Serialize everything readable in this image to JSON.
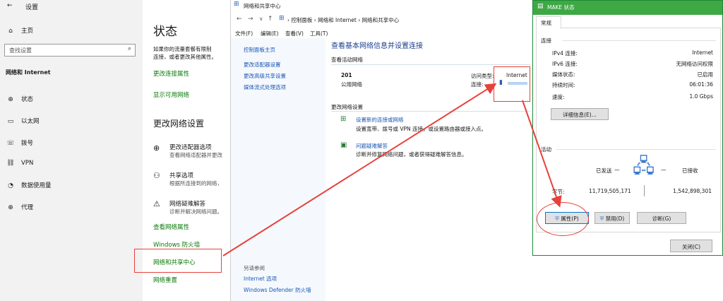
{
  "settings": {
    "title": "设置",
    "home": "主页",
    "search_placeholder": "查找设置",
    "section": "网络和 Internet",
    "nav": [
      "状态",
      "以太网",
      "拨号",
      "VPN",
      "数据使用量",
      "代理"
    ],
    "page_title": "状态",
    "intro": "如果你的流量套餐有限制",
    "intro2": "连接，或者更改其他属性。",
    "change_conn_props": "更改连接属性",
    "show_networks": "显示可用网络",
    "change_settings": "更改网络设置",
    "adapter_title": "更改适配器选项",
    "adapter_desc": "查看网络适配器并更改",
    "sharing_title": "共享选项",
    "sharing_desc": "根据所连接到的网络，",
    "trouble_title": "网络疑难解答",
    "trouble_desc": "诊断并解决网络问题。",
    "view_props": "查看网络属性",
    "firewall": "Windows 防火墙",
    "sharing_center": "网络和共享中心",
    "reset": "网络重置"
  },
  "cp": {
    "title": "网络和共享中心",
    "breadcrumb": [
      "控制面板",
      "网络和 Internet",
      "网络和共享中心"
    ],
    "menu": [
      "文件(F)",
      "编辑(E)",
      "查看(V)",
      "工具(T)"
    ],
    "left_home": "控制面板主页",
    "left_links": [
      "更改适配器设置",
      "更改高级共享设置",
      "媒体流式处理选项"
    ],
    "heading": "查看基本网络信息并设置连接",
    "active_label": "查看活动网络",
    "net_name": "201",
    "net_type": "公用网络",
    "access_label": "访问类型:",
    "access_value": "Internet",
    "conn_label": "连接:",
    "change_label": "更改网络设置",
    "new_conn_title": "设置新的连接或网络",
    "new_conn_desc": "设置宽带、拨号或 VPN 连接，或设置路由器或接入点。",
    "trouble_title": "问题疑难解答",
    "trouble_desc": "诊断并修复网络问题，或者获得疑难解答信息。",
    "see_also": "另请参阅",
    "see_also_items": [
      "Internet 选项",
      "Windows Defender 防火墙"
    ]
  },
  "dlg": {
    "title": "MAKE 状态",
    "tab": "常规",
    "conn_header": "连接",
    "rows": [
      {
        "label": "IPv4 连接:",
        "value": "Internet"
      },
      {
        "label": "IPv6 连接:",
        "value": "无网络访问权限"
      },
      {
        "label": "媒体状态:",
        "value": "已启用"
      },
      {
        "label": "持续时间:",
        "value": "06:01:36"
      },
      {
        "label": "速度:",
        "value": "1.0 Gbps"
      }
    ],
    "details_btn": "详细信息(E)...",
    "activity_header": "活动",
    "sent_label": "已发送",
    "recv_label": "已接收",
    "bytes_label": "字节:",
    "sent_value": "11,719,505,171",
    "recv_value": "1,542,898,301",
    "props_btn": "属性(P)",
    "disable_btn": "禁用(D)",
    "diagnose_btn": "诊断(G)",
    "close_btn": "关闭(C)"
  },
  "colors": {
    "annotation": "#e8413b",
    "link": "#0a7a0a",
    "cp_link": "#1a56b3",
    "titlebar": "#3ea845"
  }
}
